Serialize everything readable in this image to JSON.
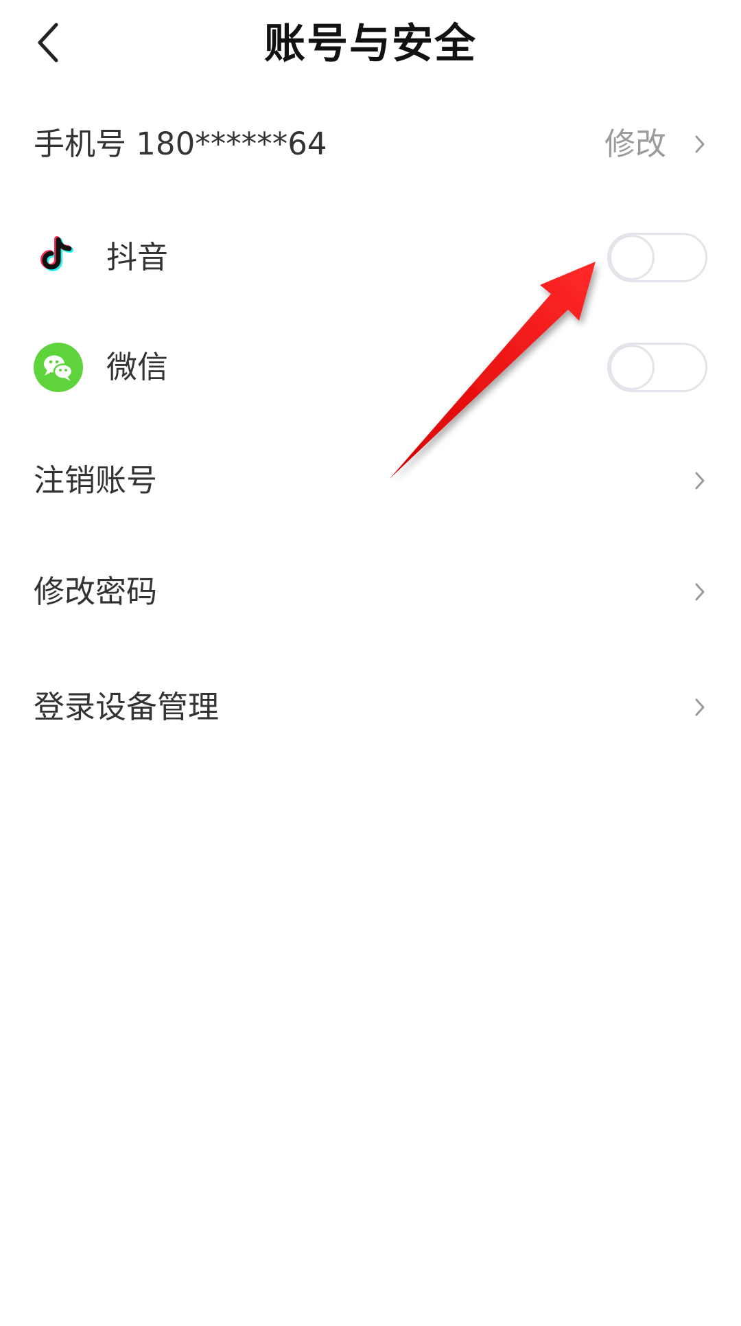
{
  "header": {
    "title": "账号与安全"
  },
  "phone_row": {
    "label": "手机号 180******64",
    "action": "修改"
  },
  "linked_accounts": [
    {
      "label": "抖音",
      "icon": "douyin-icon",
      "enabled": false
    },
    {
      "label": "微信",
      "icon": "wechat-icon",
      "enabled": false
    }
  ],
  "menu": {
    "deactivate": "注销账号",
    "change_password": "修改密码",
    "device_management": "登录设备管理"
  },
  "colors": {
    "annotation_arrow": "#ee1111",
    "wechat_green": "#5fd33b",
    "toggle_border": "#e3e3ea",
    "secondary_text": "#9b9b9b"
  }
}
